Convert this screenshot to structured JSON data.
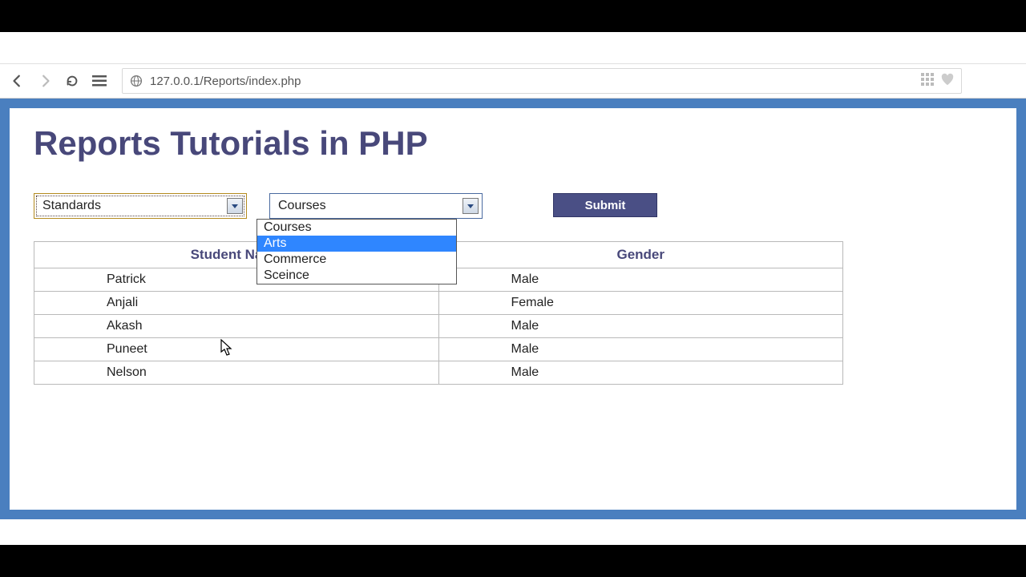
{
  "browser": {
    "url": "127.0.0.1/Reports/index.php"
  },
  "page": {
    "title": "Reports Tutorials in PHP",
    "standards_select": {
      "value": "Standards"
    },
    "courses_select": {
      "value": "Courses",
      "options": [
        "Courses",
        "Arts",
        "Commerce",
        "Sceince"
      ],
      "highlighted": "Arts"
    },
    "submit_label": "Submit",
    "table": {
      "headers": [
        "Student Name",
        "Gender"
      ],
      "rows": [
        {
          "name": "Patrick",
          "gender": "Male"
        },
        {
          "name": "Anjali",
          "gender": "Female"
        },
        {
          "name": "Akash",
          "gender": "Male"
        },
        {
          "name": "Puneet",
          "gender": "Male"
        },
        {
          "name": "Nelson",
          "gender": "Male"
        }
      ]
    }
  }
}
